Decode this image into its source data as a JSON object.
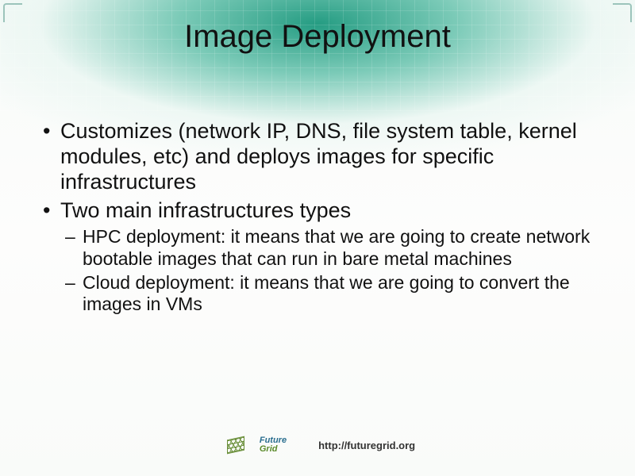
{
  "title": "Image Deployment",
  "bullets": [
    "Customizes (network IP, DNS, file system table, kernel modules, etc) and deploys images for specific infrastructures",
    "Two main infrastructures types"
  ],
  "sub_bullets": [
    "HPC deployment: it means that we are going to create network bootable images that can run in bare metal machines",
    "Cloud deployment: it means that we are going to convert the images in VMs"
  ],
  "logo": {
    "line1": "Future",
    "line2": "Grid"
  },
  "footer_url": "http://futuregrid.org"
}
